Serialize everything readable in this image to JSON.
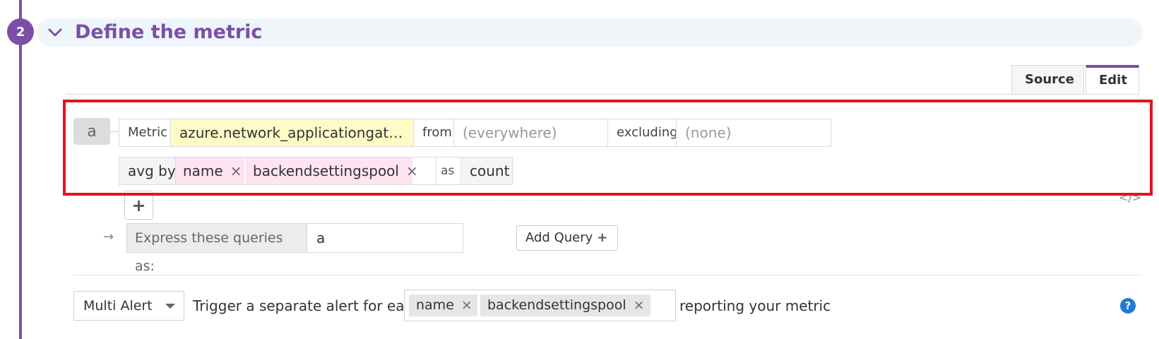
{
  "step": {
    "number": "2",
    "title": "Define the metric"
  },
  "tabs": {
    "source": "Source",
    "edit": "Edit"
  },
  "query": {
    "letter": "a",
    "metric_label": "Metric",
    "metric_value": "azure.network_applicationgatewa...",
    "from_label": "from",
    "from_placeholder": "(everywhere)",
    "excluding_label": "excluding",
    "excluding_placeholder": "(none)",
    "avg_by_label": "avg by",
    "group_tags": [
      "name",
      "backendsettingspool"
    ],
    "tag_remove": "×",
    "as_label": "as",
    "as_value": "count"
  },
  "add_icon": "+",
  "code_icon": "</>",
  "express": {
    "arrow": "→",
    "label": "Express these queries as:",
    "value": "a"
  },
  "add_query": {
    "label": "Add Query",
    "plus": "+"
  },
  "alert": {
    "mode": "Multi Alert",
    "trigger_text": "Trigger a separate alert for each",
    "tags": [
      "name",
      "backendsettingspool"
    ],
    "reporting_text": "reporting your metric",
    "help": "?"
  },
  "colors": {
    "accent": "#7b4fa8",
    "highlight": "#e0141e",
    "metric_bg": "#fdfbc6",
    "tag_bg": "#fde4f0",
    "help": "#1f7ad1"
  }
}
